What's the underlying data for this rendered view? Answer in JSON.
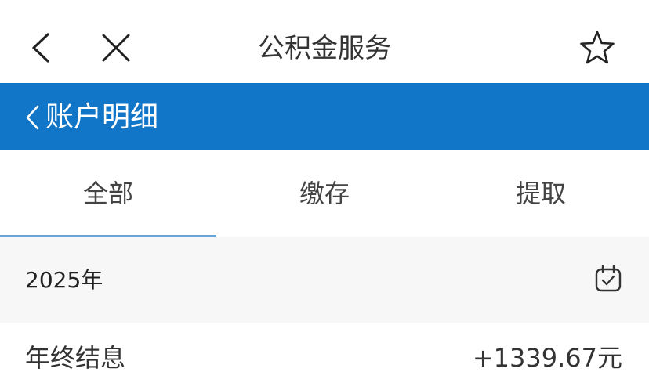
{
  "topbar": {
    "title": "公积金服务",
    "back_icon": "chevron-left-icon",
    "close_icon": "close-icon",
    "favorite_icon": "star-outline-icon"
  },
  "header": {
    "title": "账户明细",
    "back_icon": "chevron-left-icon",
    "color": "#1176c8"
  },
  "tabs": [
    {
      "label": "全部",
      "active": true
    },
    {
      "label": "缴存",
      "active": false
    },
    {
      "label": "提取",
      "active": false
    }
  ],
  "filter": {
    "year": "2025年",
    "calendar_icon": "calendar-check-icon"
  },
  "records": [
    {
      "label": "年终结息",
      "amount": "+1339.67元"
    }
  ]
}
